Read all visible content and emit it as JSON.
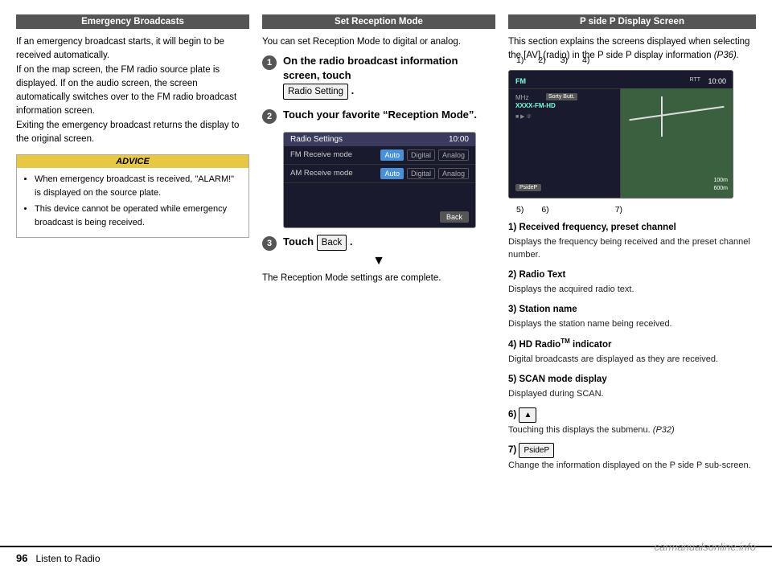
{
  "left_col": {
    "header": "Emergency Broadcasts",
    "body": "If an emergency broadcast starts, it will begin to be received automatically.\nIf on the map screen, the FM radio source plate is displayed. If on the audio screen, the screen automatically switches over to the FM radio broadcast information screen.\nExiting the emergency broadcast returns the display to the original screen.",
    "advice_header": "ADVICE",
    "advice_items": [
      "When emergency broadcast is received, \"ALARM!\" is displayed on the source plate.",
      "This device cannot be operated while emergency broadcast is being received."
    ]
  },
  "middle_col": {
    "header": "Set Reception Mode",
    "intro": "You can set Reception Mode to digital or analog.",
    "step1_text": "On the radio broadcast information screen, touch",
    "step1_btn": "Radio Setting",
    "step1_suffix": ".",
    "step2_text": "Touch your favorite “Reception Mode”.",
    "radio_settings_title": "Radio Settings",
    "radio_settings_time": "10:00",
    "radio_settings_rows": [
      {
        "label": "FM Receive mode",
        "options": [
          "Auto",
          "Digital",
          "Analog"
        ],
        "active": "Auto"
      },
      {
        "label": "AM Receive mode",
        "options": [
          "Auto",
          "Digital",
          "Analog"
        ],
        "active": "Auto"
      }
    ],
    "back_btn": "Back",
    "step3_text": "Touch",
    "step3_btn": "Back",
    "step3_suffix": ".",
    "arrow": "▼",
    "complete_text": "The Reception Mode settings are complete."
  },
  "right_col": {
    "header": "P side P Display Screen",
    "intro": "This section explains the screens displayed when selecting the [AV] (radio) in the P side P display information",
    "intro_ref": "(P36).",
    "screen_labels_top": [
      "1)",
      "2)",
      "3)",
      "4)"
    ],
    "screen_labels_bottom": [
      "5)",
      "6)",
      "7)"
    ],
    "screen_fm": "FM",
    "screen_time": "10:00",
    "screen_sorty": "Sorty Butt.",
    "screen_freq": "MHz\nXXXX-FM-HD",
    "screen_pside": "PsideP",
    "items": [
      {
        "num": "1)",
        "title": "Received frequency, preset channel",
        "desc": "Displays the frequency being received and the preset channel number."
      },
      {
        "num": "2)",
        "title": "Radio Text",
        "desc": "Displays the acquired radio text."
      },
      {
        "num": "3)",
        "title": "Station name",
        "desc": "Displays the station name being received."
      },
      {
        "num": "4)",
        "title_pre": "HD Radio",
        "title_tm": "TM",
        "title_post": " indicator",
        "desc": "Digital broadcasts are displayed as they are received."
      },
      {
        "num": "5)",
        "title": "SCAN mode display",
        "desc": "Displayed during SCAN."
      },
      {
        "num": "6)",
        "btn_label": "▲",
        "desc": "Touching this displays the submenu.",
        "desc_ref": "(P32)"
      },
      {
        "num": "7)",
        "btn_label": "PsideP",
        "desc": "Change the information displayed on the P side P sub-screen."
      }
    ]
  },
  "footer": {
    "page_num": "96",
    "page_title": "Listen to Radio"
  },
  "watermark": "carmanualsonline.info"
}
